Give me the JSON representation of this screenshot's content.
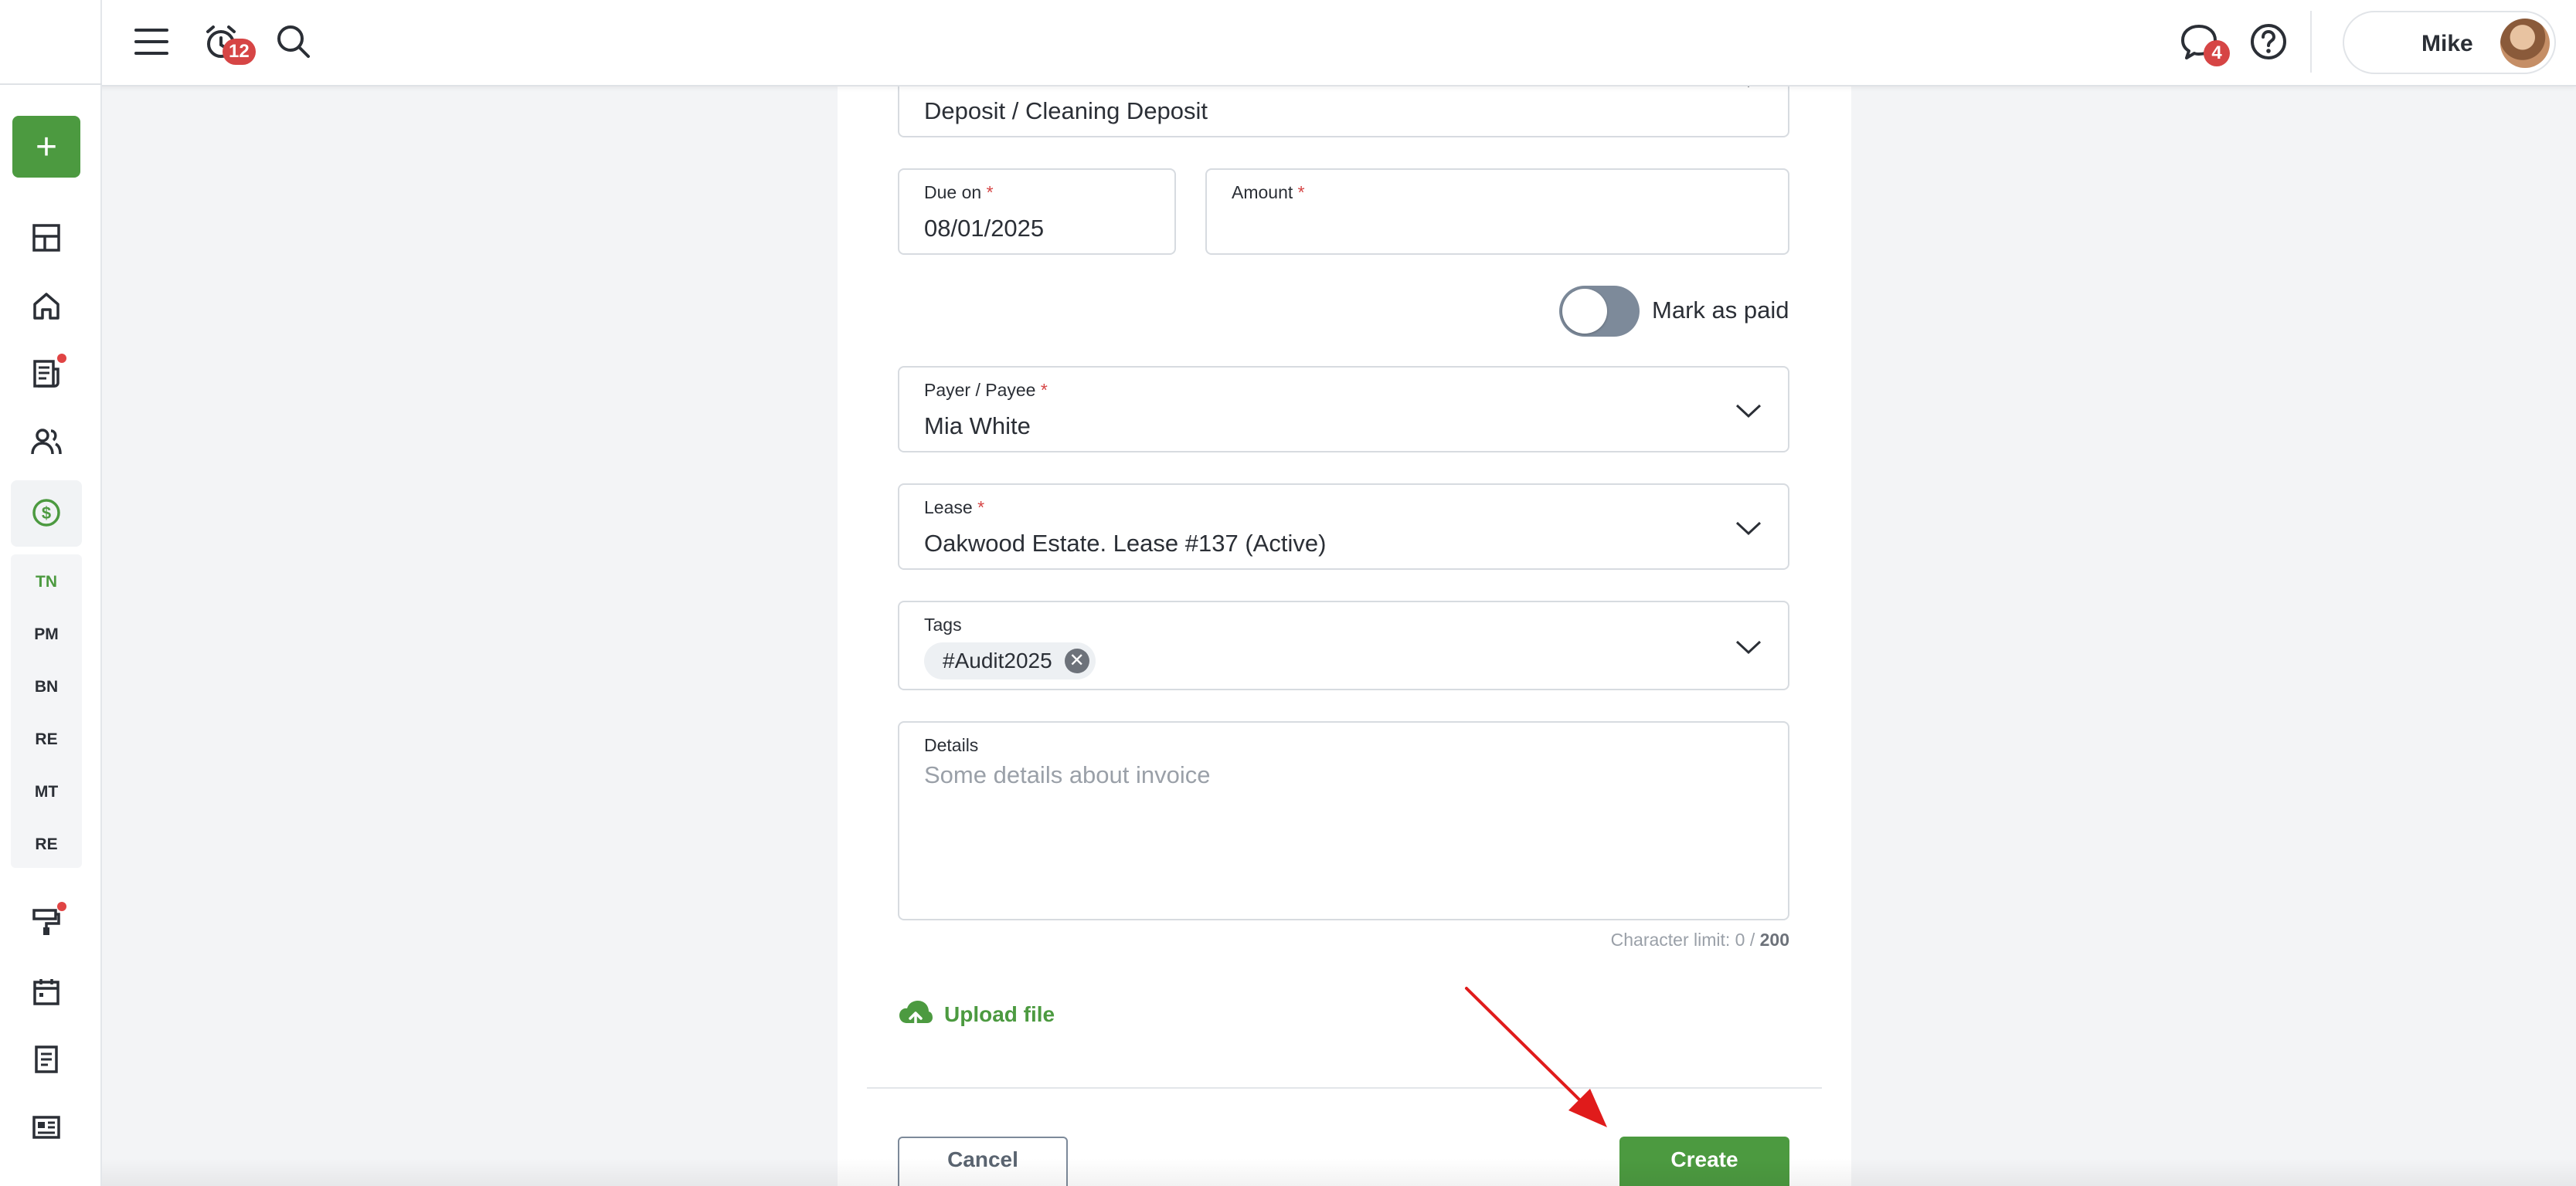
{
  "topbar": {
    "menu_icon": "hamburger-menu-icon",
    "alarm_icon": "alarm-clock-icon",
    "alarm_badge": "12",
    "search_icon": "search-icon",
    "chat_icon": "chat-bubble-icon",
    "chat_badge": "4",
    "help_icon": "help-circle-icon",
    "user_name": "Mike"
  },
  "sidebar": {
    "add_button_label": "+",
    "icons": [
      "dashboard-icon",
      "home-icon",
      "news-icon",
      "people-icon",
      "dollar-icon",
      "paint-roller-icon",
      "calendar-icon",
      "document-icon",
      "id-card-icon"
    ],
    "text_items": [
      "TN",
      "PM",
      "BN",
      "RE",
      "MT",
      "RE"
    ],
    "active_item": "TN"
  },
  "form": {
    "category_value": "Deposit / Cleaning Deposit",
    "due_on_label": "Due on",
    "due_on_value": "08/01/2025",
    "amount_label": "Amount",
    "amount_value": "",
    "mark_paid_label": "Mark as paid",
    "mark_paid_on": false,
    "payer_label": "Payer / Payee",
    "payer_value": "Mia White",
    "lease_label": "Lease",
    "lease_value": "Oakwood Estate. Lease #137 (Active)",
    "tags_label": "Tags",
    "tags": [
      "#Audit2025"
    ],
    "details_label": "Details",
    "details_placeholder": "Some details about invoice",
    "char_limit_prefix": "Character limit: 0 / ",
    "char_limit_max": "200",
    "upload_label": "Upload file",
    "required_mark": "*"
  },
  "actions": {
    "cancel_label": "Cancel",
    "create_label": "Create"
  },
  "colors": {
    "accent_green": "#4c9a40",
    "badge_red": "#d64545",
    "annotation_arrow": "#e01b1b"
  }
}
